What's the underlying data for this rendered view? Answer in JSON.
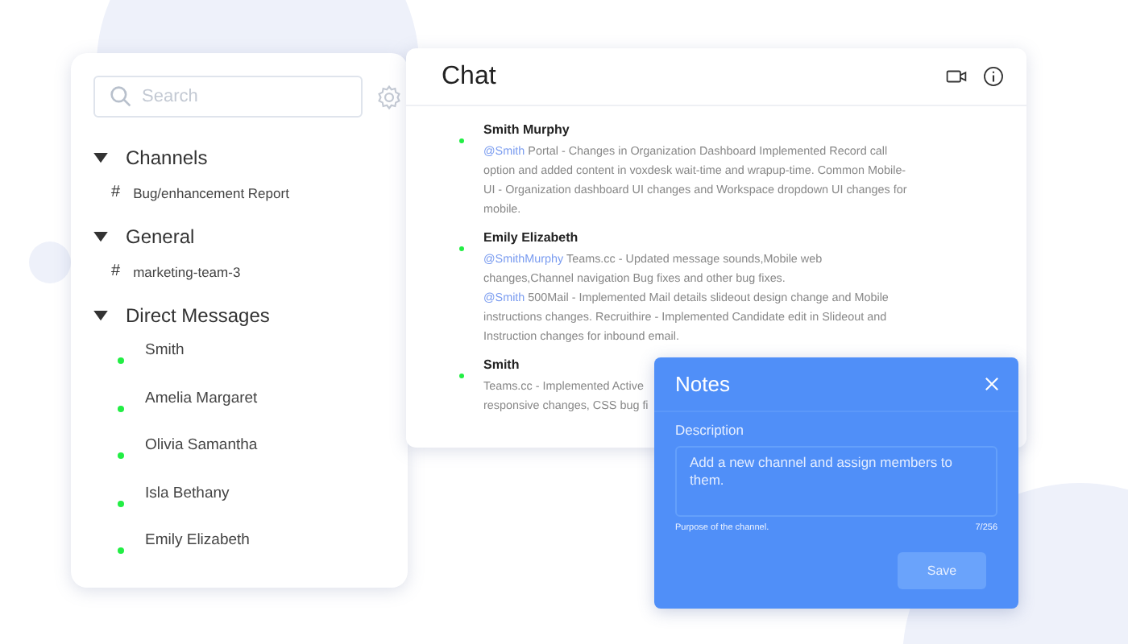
{
  "sidebar": {
    "search": {
      "placeholder": "Search"
    },
    "sections": [
      {
        "title": "Channels",
        "expanded": true,
        "items": [
          {
            "prefix": "#",
            "label": "Bug/enhancement Report"
          }
        ]
      },
      {
        "title": "General",
        "expanded": true,
        "items": [
          {
            "prefix": "#",
            "label": "marketing-team-3"
          }
        ]
      }
    ],
    "direct_messages": {
      "title": "Direct Messages",
      "expanded": true,
      "items": [
        {
          "name": "Smith",
          "online": true
        },
        {
          "name": "Amelia Margaret",
          "online": true
        },
        {
          "name": "Olivia Samantha",
          "online": true
        },
        {
          "name": "Isla Bethany",
          "online": true
        },
        {
          "name": "Emily Elizabeth",
          "online": true
        }
      ]
    }
  },
  "chat": {
    "title": "Chat",
    "messages": [
      {
        "author": "Smith Murphy",
        "online": true,
        "paragraphs": [
          {
            "mention": "@Smith",
            "text": "Portal - Changes in Organization Dashboard Implemented Record call option and added content in voxdesk wait-time and wrapup-time. Common Mobile-UI - Organization dashboard UI changes and Workspace dropdown UI changes for mobile."
          }
        ]
      },
      {
        "author": "Emily Elizabeth",
        "online": true,
        "paragraphs": [
          {
            "mention": "@SmithMurphy",
            "text": "Teams.cc - Updated message sounds,Mobile web changes,Channel navigation Bug fixes and other bug fixes."
          },
          {
            "mention": "@Smith",
            "text": "500Mail - Implemented Mail details slideout design change and Mobile instructions changes. Recruithire - Implemented Candidate edit in Slideout and Instruction changes for inbound email."
          }
        ]
      },
      {
        "author": "Smith",
        "online": true,
        "lines": [
          "Teams.cc - Implemented Active",
          "responsive changes, CSS bug fi"
        ]
      }
    ]
  },
  "notes": {
    "title": "Notes",
    "label": "Description",
    "placeholder": "Add a new channel and assign members to them.",
    "hint": "Purpose of the channel.",
    "count": "7/256",
    "button": {
      "label": "Save",
      "disabled": true
    }
  }
}
